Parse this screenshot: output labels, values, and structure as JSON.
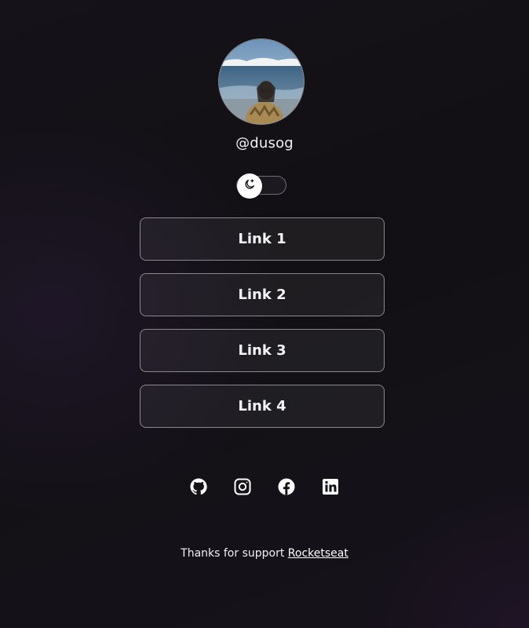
{
  "profile": {
    "username": "@dusog"
  },
  "theme_toggle": {
    "icon": "moon-stars-icon"
  },
  "links": [
    {
      "label": "Link 1"
    },
    {
      "label": "Link 2"
    },
    {
      "label": "Link 3"
    },
    {
      "label": "Link 4"
    }
  ],
  "socials": [
    {
      "icon": "github-icon"
    },
    {
      "icon": "instagram-icon"
    },
    {
      "icon": "facebook-icon"
    },
    {
      "icon": "linkedin-icon"
    }
  ],
  "footer": {
    "text": "Thanks for support ",
    "link_label": "Rocketseat"
  },
  "colors": {
    "background": "#131116",
    "button_border": "#8a878f",
    "text": "#f4f4f6"
  }
}
